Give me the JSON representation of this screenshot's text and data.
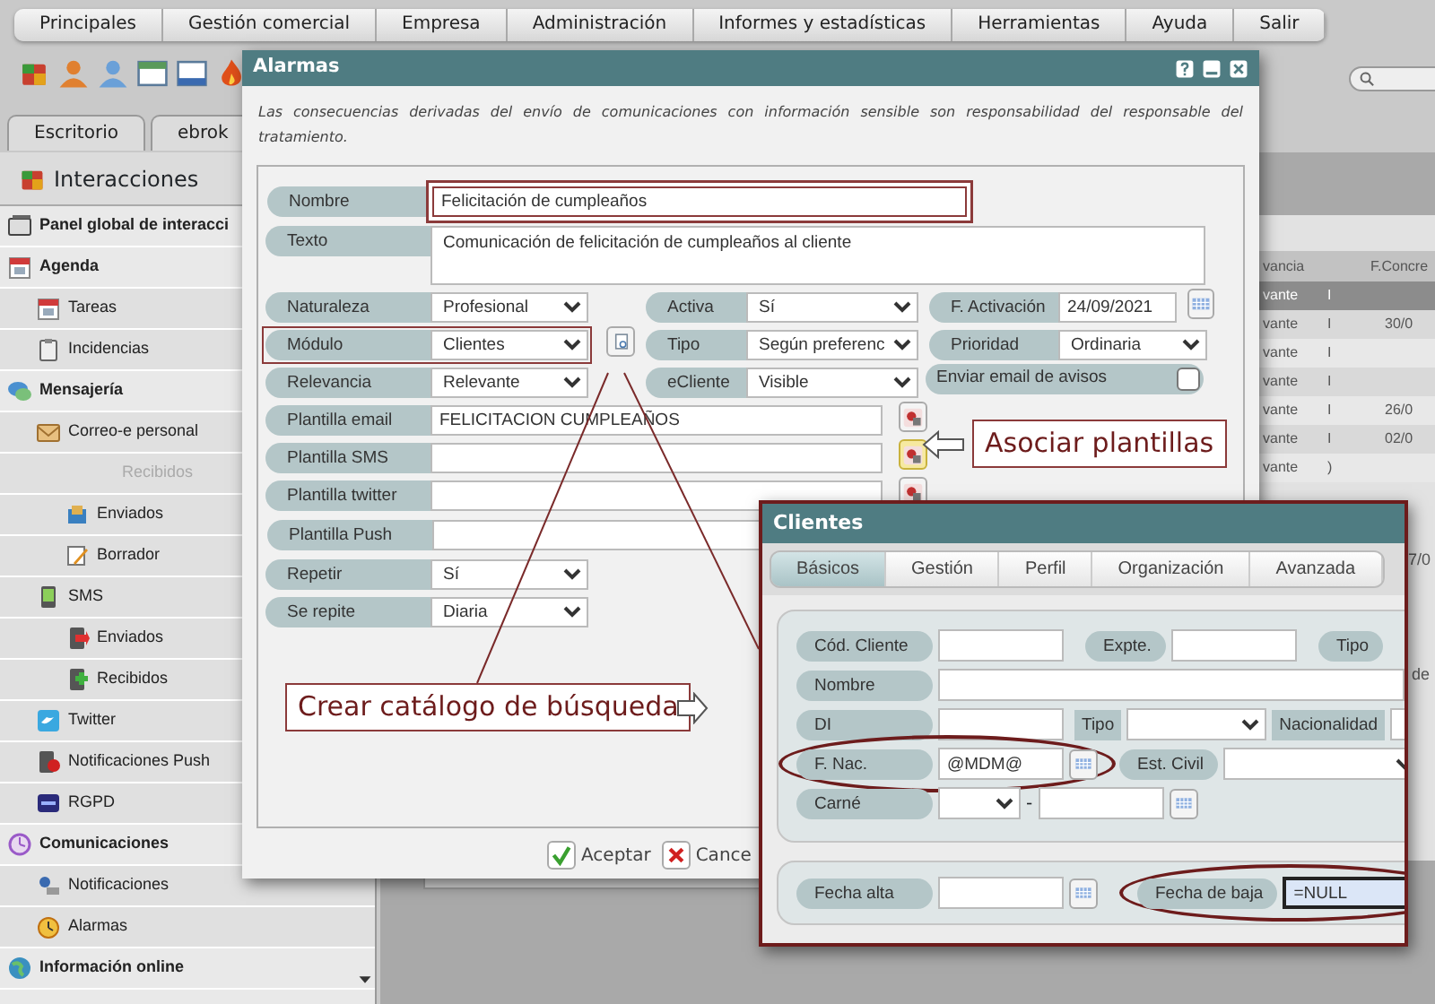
{
  "menu": [
    {
      "label": "Principales"
    },
    {
      "label": "Gestión comercial"
    },
    {
      "label": "Empresa"
    },
    {
      "label": "Administración"
    },
    {
      "label": "Informes y estadísticas"
    },
    {
      "label": "Herramientas"
    },
    {
      "label": "Ayuda"
    },
    {
      "label": "Salir"
    }
  ],
  "app_tabs": [
    {
      "label": "Escritorio",
      "selected": false
    },
    {
      "label": "ebrok",
      "selected": false
    }
  ],
  "sidebar": {
    "title": "Interacciones",
    "items": [
      {
        "label": "Panel global de interacci",
        "disabled": false
      },
      {
        "label": "Agenda",
        "disabled": false,
        "children": [
          {
            "label": "Tareas",
            "disabled": false
          },
          {
            "label": "Incidencias",
            "disabled": false
          }
        ]
      },
      {
        "label": "Mensajería",
        "disabled": false,
        "children": [
          {
            "label": "Correo-e personal",
            "disabled": false,
            "children": [
              {
                "label": "Recibidos",
                "disabled": true
              },
              {
                "label": "Enviados",
                "disabled": false
              },
              {
                "label": "Borrador",
                "disabled": false
              }
            ]
          },
          {
            "label": "SMS",
            "disabled": false,
            "children": [
              {
                "label": "Enviados",
                "disabled": false
              },
              {
                "label": "Recibidos",
                "disabled": false
              }
            ]
          },
          {
            "label": "Twitter",
            "disabled": false
          },
          {
            "label": "Notificaciones Push",
            "disabled": false
          },
          {
            "label": "RGPD",
            "disabled": false
          }
        ]
      },
      {
        "label": "Comunicaciones",
        "disabled": false,
        "children": [
          {
            "label": "Notificaciones",
            "disabled": false
          },
          {
            "label": "Alarmas",
            "disabled": false
          }
        ]
      },
      {
        "label": "Información online",
        "disabled": false
      }
    ]
  },
  "background_table": {
    "columns": [
      "vancia",
      "",
      "F.Concre"
    ],
    "rows": [
      {
        "cells": [
          "vante",
          "I"
        ],
        "selected": true
      },
      {
        "cells": [
          "vante",
          "I",
          "30/0"
        ],
        "selected": false
      },
      {
        "cells": [
          "vante",
          "I"
        ],
        "selected": false
      },
      {
        "cells": [
          "vante",
          "I"
        ],
        "selected": false
      },
      {
        "cells": [
          "vante",
          "I",
          "26/0"
        ],
        "selected": false
      },
      {
        "cells": [
          "vante",
          "I",
          "02/0"
        ],
        "selected": false
      },
      {
        "cells": [
          "vante",
          ")"
        ],
        "selected": false
      }
    ],
    "fragments": [
      "7/0",
      "de"
    ]
  },
  "alarm_dialog": {
    "title": "Alarmas",
    "notice": "Las consecuencias derivadas del envío de comunicaciones con información sensible son responsabilidad del responsable del tratamiento.",
    "rows": [
      [
        {
          "label": "Nombre",
          "kind": "text",
          "value": "Felicitación de cumpleaños",
          "highlighted": true
        }
      ],
      [
        {
          "label": "Texto",
          "kind": "textarea",
          "value": "Comunicación de felicitación de cumpleaños al cliente",
          "highlighted": false
        }
      ],
      [
        {
          "label": "Naturaleza",
          "kind": "select",
          "value": "Profesional",
          "highlighted": false
        },
        {
          "label": "Activa",
          "kind": "select",
          "value": "Sí",
          "highlighted": false
        },
        {
          "label": "F. Activación",
          "kind": "date",
          "value": "24/09/2021",
          "highlighted": false
        }
      ],
      [
        {
          "label": "Módulo",
          "kind": "catalog",
          "value": "Clientes",
          "highlighted": true
        },
        {
          "label": "Tipo",
          "kind": "select",
          "value": "Según preferenc",
          "highlighted": false
        },
        {
          "label": "Prioridad",
          "kind": "select",
          "value": "Ordinaria",
          "highlighted": false
        }
      ],
      [
        {
          "label": "Relevancia",
          "kind": "select",
          "value": "Relevante",
          "highlighted": false
        },
        {
          "label": "eCliente",
          "kind": "select",
          "value": "Visible",
          "highlighted": false
        },
        {
          "label": "Enviar email de avisos",
          "kind": "checkbox",
          "checked": false,
          "highlighted": false
        }
      ],
      [
        {
          "label": "Plantilla email",
          "kind": "template",
          "value": "FELICITACION CUMPLEAÑOS",
          "active": false,
          "highlighted": false
        }
      ],
      [
        {
          "label": "Plantilla SMS",
          "kind": "template",
          "active": true,
          "highlighted": false
        }
      ],
      [
        {
          "label": "Plantilla twitter",
          "kind": "template",
          "active": false,
          "highlighted": false
        }
      ],
      [
        {
          "label": "Plantilla Push",
          "kind": "text",
          "highlighted": false
        }
      ],
      [
        {
          "label": "Repetir",
          "kind": "select",
          "value": "Sí",
          "highlighted": false
        }
      ],
      [
        {
          "label": "Se repite",
          "kind": "select",
          "value": "Diaria",
          "highlighted": false
        }
      ]
    ],
    "buttons": [
      {
        "label": "Aceptar",
        "kind": "ok"
      },
      {
        "label": "Cance",
        "kind": "cancel"
      }
    ]
  },
  "clients_dialog": {
    "title": "Clientes",
    "tabs": [
      {
        "label": "Básicos",
        "selected": true
      },
      {
        "label": "Gestión",
        "selected": false
      },
      {
        "label": "Perfil",
        "selected": false
      },
      {
        "label": "Organización",
        "selected": false
      },
      {
        "label": "Avanzada",
        "selected": false
      }
    ],
    "sections": [
      [
        [
          {
            "label": "Cód. Cliente",
            "kind": "text",
            "circled": false,
            "focused": false
          },
          {
            "label": "Expte.",
            "kind": "text",
            "circled": false,
            "focused": false
          },
          {
            "label": "Tipo",
            "kind": "label",
            "circled": false
          }
        ],
        [
          {
            "label": "Nombre",
            "kind": "text",
            "circled": false,
            "focused": false
          }
        ],
        [
          {
            "label": "DI",
            "kind": "text",
            "circled": false,
            "focused": false
          },
          {
            "label": "Tipo",
            "kind": "flat_select",
            "circled": false,
            "focused": false
          },
          {
            "label": "Nacionalidad",
            "kind": "flat_text",
            "circled": false,
            "focused": false
          }
        ],
        [
          {
            "label": "F. Nac.",
            "kind": "date",
            "value": "@MDM@",
            "circled": true,
            "focused": false
          },
          {
            "label": "Est. Civil",
            "kind": "select",
            "circled": false,
            "focused": false
          }
        ],
        [
          {
            "label": "Carné",
            "kind": "carne",
            "separator": "-",
            "circled": false
          }
        ]
      ],
      [
        [
          {
            "label": "Fecha alta",
            "kind": "date",
            "circled": false,
            "focused": false
          },
          {
            "label": "Fecha de baja",
            "kind": "date",
            "value": "=NULL",
            "circled": true,
            "focused": true
          }
        ]
      ]
    ]
  },
  "annotations": [
    {
      "kind": "left",
      "text": "Asociar plantillas"
    },
    {
      "kind": "right",
      "text": "Crear catálogo de búsqueda"
    }
  ]
}
